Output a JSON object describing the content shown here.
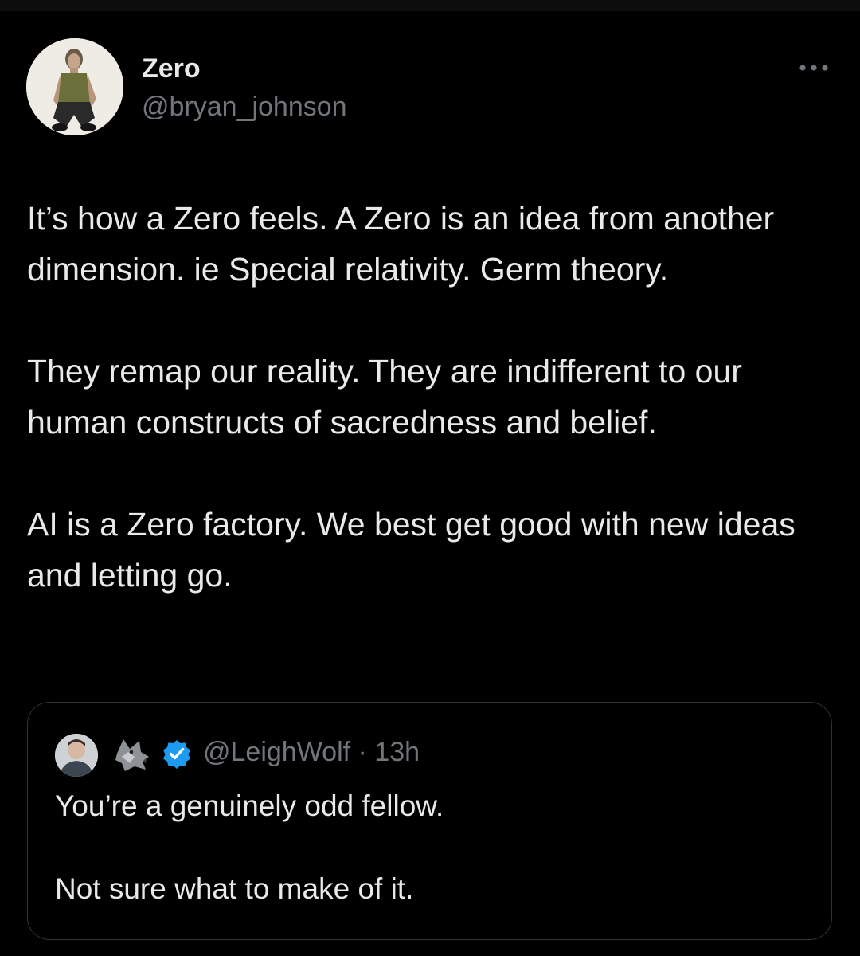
{
  "author": {
    "display_name": "Zero",
    "handle": "@bryan_johnson",
    "avatar_icon": "profile-photo"
  },
  "more_icon": "more-horizontal-icon",
  "tweet": {
    "paragraphs": [
      "It’s how a Zero feels. A Zero is an idea from another dimension. ie Special relativity. Germ theory.",
      "They remap our reality. They are indifferent to our human constructs of sacredness and belief.",
      "AI is a Zero factory. We best get good with new ideas and letting go."
    ]
  },
  "quote": {
    "avatar_icon": "profile-photo",
    "wolf_icon": "wolf-emoji-icon",
    "verified_icon": "verified-badge-icon",
    "handle_line": "@LeighWolf · 13h",
    "paragraphs": [
      "You’re a genuinely odd fellow.",
      "Not sure what to make of it."
    ]
  },
  "colors": {
    "background": "#000000",
    "primary_text": "#e7e9ea",
    "secondary_text": "#71767b",
    "border": "#2f3336",
    "verified_blue": "#1d9bf0"
  }
}
